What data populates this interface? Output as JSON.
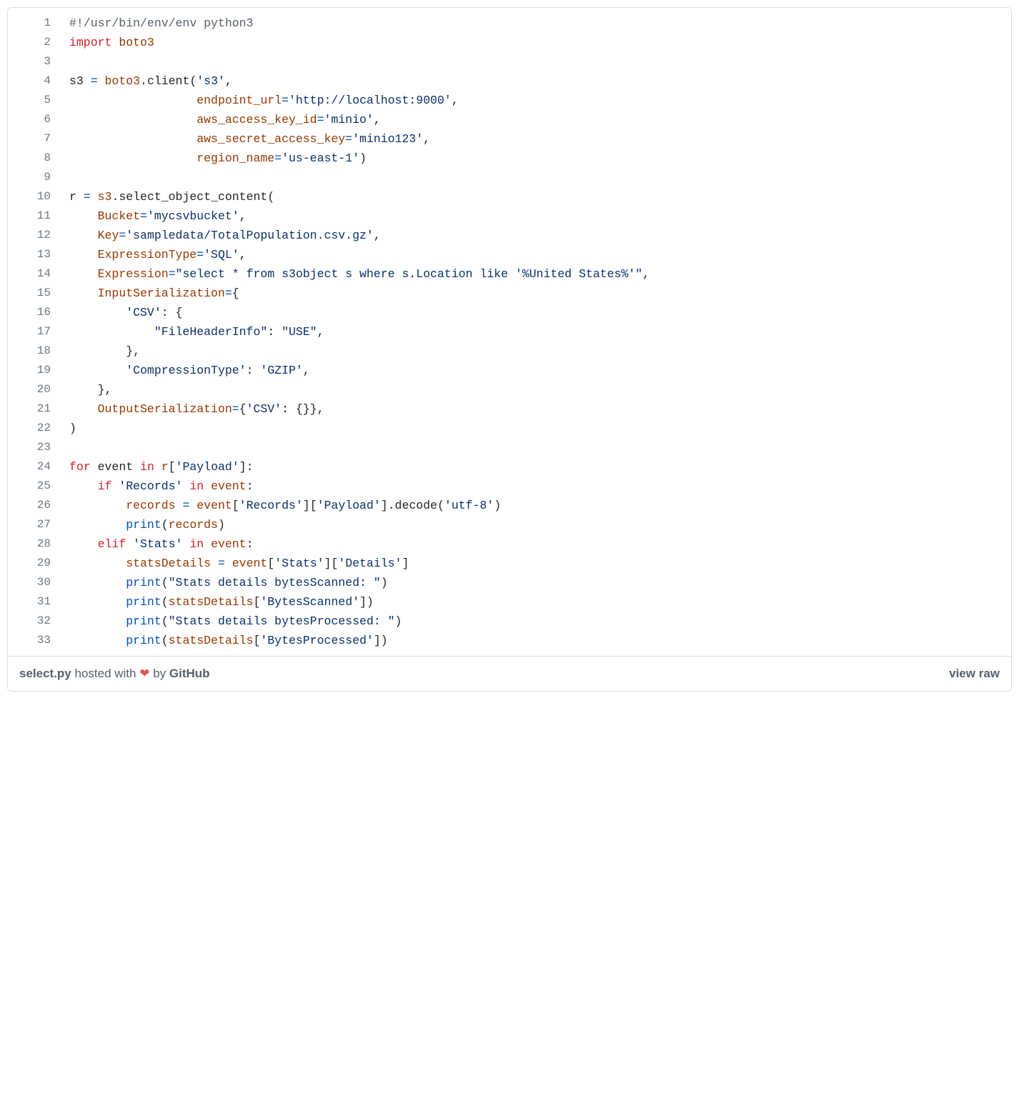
{
  "meta": {
    "filename": "select.py",
    "hosted_with": " hosted with ",
    "by": "  by ",
    "github": "GitHub",
    "view_raw": "view raw",
    "heart": "❤"
  },
  "lines": [
    {
      "n": "1",
      "tokens": [
        [
          "c-cmt",
          "#!/usr/bin/env/env python3"
        ]
      ]
    },
    {
      "n": "2",
      "tokens": [
        [
          "c-kw",
          "import"
        ],
        [
          "c-id",
          " "
        ],
        [
          "c-var",
          "boto3"
        ]
      ]
    },
    {
      "n": "3",
      "tokens": [
        [
          "c-id",
          ""
        ]
      ]
    },
    {
      "n": "4",
      "tokens": [
        [
          "c-id",
          "s3 "
        ],
        [
          "c-op",
          "="
        ],
        [
          "c-id",
          " "
        ],
        [
          "c-var",
          "boto3"
        ],
        [
          "c-id",
          "."
        ],
        [
          "c-id",
          "client"
        ],
        [
          "c-id",
          "("
        ],
        [
          "c-str",
          "'s3'"
        ],
        [
          "c-id",
          ","
        ]
      ]
    },
    {
      "n": "5",
      "tokens": [
        [
          "c-id",
          "                  "
        ],
        [
          "c-var",
          "endpoint_url"
        ],
        [
          "c-op",
          "="
        ],
        [
          "c-str",
          "'http://localhost:9000'"
        ],
        [
          "c-id",
          ","
        ]
      ]
    },
    {
      "n": "6",
      "tokens": [
        [
          "c-id",
          "                  "
        ],
        [
          "c-var",
          "aws_access_key_id"
        ],
        [
          "c-op",
          "="
        ],
        [
          "c-str",
          "'minio'"
        ],
        [
          "c-id",
          ","
        ]
      ]
    },
    {
      "n": "7",
      "tokens": [
        [
          "c-id",
          "                  "
        ],
        [
          "c-var",
          "aws_secret_access_key"
        ],
        [
          "c-op",
          "="
        ],
        [
          "c-str",
          "'minio123'"
        ],
        [
          "c-id",
          ","
        ]
      ]
    },
    {
      "n": "8",
      "tokens": [
        [
          "c-id",
          "                  "
        ],
        [
          "c-var",
          "region_name"
        ],
        [
          "c-op",
          "="
        ],
        [
          "c-str",
          "'us-east-1'"
        ],
        [
          "c-id",
          ")"
        ]
      ]
    },
    {
      "n": "9",
      "tokens": [
        [
          "c-id",
          ""
        ]
      ]
    },
    {
      "n": "10",
      "tokens": [
        [
          "c-id",
          "r "
        ],
        [
          "c-op",
          "="
        ],
        [
          "c-id",
          " "
        ],
        [
          "c-var",
          "s3"
        ],
        [
          "c-id",
          "."
        ],
        [
          "c-id",
          "select_object_content"
        ],
        [
          "c-id",
          "("
        ]
      ]
    },
    {
      "n": "11",
      "tokens": [
        [
          "c-id",
          "    "
        ],
        [
          "c-var",
          "Bucket"
        ],
        [
          "c-op",
          "="
        ],
        [
          "c-str",
          "'mycsvbucket'"
        ],
        [
          "c-id",
          ","
        ]
      ]
    },
    {
      "n": "12",
      "tokens": [
        [
          "c-id",
          "    "
        ],
        [
          "c-var",
          "Key"
        ],
        [
          "c-op",
          "="
        ],
        [
          "c-str",
          "'sampledata/TotalPopulation.csv.gz'"
        ],
        [
          "c-id",
          ","
        ]
      ]
    },
    {
      "n": "13",
      "tokens": [
        [
          "c-id",
          "    "
        ],
        [
          "c-var",
          "ExpressionType"
        ],
        [
          "c-op",
          "="
        ],
        [
          "c-str",
          "'SQL'"
        ],
        [
          "c-id",
          ","
        ]
      ]
    },
    {
      "n": "14",
      "tokens": [
        [
          "c-id",
          "    "
        ],
        [
          "c-var",
          "Expression"
        ],
        [
          "c-op",
          "="
        ],
        [
          "c-str",
          "\"select * from s3object s where s.Location like '%United States%'\""
        ],
        [
          "c-id",
          ","
        ]
      ]
    },
    {
      "n": "15",
      "tokens": [
        [
          "c-id",
          "    "
        ],
        [
          "c-var",
          "InputSerialization"
        ],
        [
          "c-op",
          "="
        ],
        [
          "c-id",
          "{"
        ]
      ]
    },
    {
      "n": "16",
      "tokens": [
        [
          "c-id",
          "        "
        ],
        [
          "c-str",
          "'CSV'"
        ],
        [
          "c-id",
          ": {"
        ]
      ]
    },
    {
      "n": "17",
      "tokens": [
        [
          "c-id",
          "            "
        ],
        [
          "c-str",
          "\"FileHeaderInfo\""
        ],
        [
          "c-id",
          ": "
        ],
        [
          "c-str",
          "\"USE\""
        ],
        [
          "c-id",
          ","
        ]
      ]
    },
    {
      "n": "18",
      "tokens": [
        [
          "c-id",
          "        },"
        ]
      ]
    },
    {
      "n": "19",
      "tokens": [
        [
          "c-id",
          "        "
        ],
        [
          "c-str",
          "'CompressionType'"
        ],
        [
          "c-id",
          ": "
        ],
        [
          "c-str",
          "'GZIP'"
        ],
        [
          "c-id",
          ","
        ]
      ]
    },
    {
      "n": "20",
      "tokens": [
        [
          "c-id",
          "    },"
        ]
      ]
    },
    {
      "n": "21",
      "tokens": [
        [
          "c-id",
          "    "
        ],
        [
          "c-var",
          "OutputSerialization"
        ],
        [
          "c-op",
          "="
        ],
        [
          "c-id",
          "{"
        ],
        [
          "c-str",
          "'CSV'"
        ],
        [
          "c-id",
          ": {}},"
        ]
      ]
    },
    {
      "n": "22",
      "tokens": [
        [
          "c-id",
          ")"
        ]
      ]
    },
    {
      "n": "23",
      "tokens": [
        [
          "c-id",
          ""
        ]
      ]
    },
    {
      "n": "24",
      "tokens": [
        [
          "c-kw",
          "for"
        ],
        [
          "c-id",
          " event "
        ],
        [
          "c-kw",
          "in"
        ],
        [
          "c-id",
          " "
        ],
        [
          "c-var",
          "r"
        ],
        [
          "c-id",
          "["
        ],
        [
          "c-str",
          "'Payload'"
        ],
        [
          "c-id",
          "]:"
        ]
      ]
    },
    {
      "n": "25",
      "tokens": [
        [
          "c-id",
          "    "
        ],
        [
          "c-kw",
          "if"
        ],
        [
          "c-id",
          " "
        ],
        [
          "c-str",
          "'Records'"
        ],
        [
          "c-id",
          " "
        ],
        [
          "c-kw",
          "in"
        ],
        [
          "c-id",
          " "
        ],
        [
          "c-var",
          "event"
        ],
        [
          "c-id",
          ":"
        ]
      ]
    },
    {
      "n": "26",
      "tokens": [
        [
          "c-id",
          "        "
        ],
        [
          "c-var",
          "records"
        ],
        [
          "c-id",
          " "
        ],
        [
          "c-op",
          "="
        ],
        [
          "c-id",
          " "
        ],
        [
          "c-var",
          "event"
        ],
        [
          "c-id",
          "["
        ],
        [
          "c-str",
          "'Records'"
        ],
        [
          "c-id",
          "]["
        ],
        [
          "c-str",
          "'Payload'"
        ],
        [
          "c-id",
          "]."
        ],
        [
          "c-id",
          "decode"
        ],
        [
          "c-id",
          "("
        ],
        [
          "c-str",
          "'utf-8'"
        ],
        [
          "c-id",
          ")"
        ]
      ]
    },
    {
      "n": "27",
      "tokens": [
        [
          "c-id",
          "        "
        ],
        [
          "c-fn",
          "print"
        ],
        [
          "c-id",
          "("
        ],
        [
          "c-var",
          "records"
        ],
        [
          "c-id",
          ")"
        ]
      ]
    },
    {
      "n": "28",
      "tokens": [
        [
          "c-id",
          "    "
        ],
        [
          "c-kw",
          "elif"
        ],
        [
          "c-id",
          " "
        ],
        [
          "c-str",
          "'Stats'"
        ],
        [
          "c-id",
          " "
        ],
        [
          "c-kw",
          "in"
        ],
        [
          "c-id",
          " "
        ],
        [
          "c-var",
          "event"
        ],
        [
          "c-id",
          ":"
        ]
      ]
    },
    {
      "n": "29",
      "tokens": [
        [
          "c-id",
          "        "
        ],
        [
          "c-var",
          "statsDetails"
        ],
        [
          "c-id",
          " "
        ],
        [
          "c-op",
          "="
        ],
        [
          "c-id",
          " "
        ],
        [
          "c-var",
          "event"
        ],
        [
          "c-id",
          "["
        ],
        [
          "c-str",
          "'Stats'"
        ],
        [
          "c-id",
          "]["
        ],
        [
          "c-str",
          "'Details'"
        ],
        [
          "c-id",
          "]"
        ]
      ]
    },
    {
      "n": "30",
      "tokens": [
        [
          "c-id",
          "        "
        ],
        [
          "c-fn",
          "print"
        ],
        [
          "c-id",
          "("
        ],
        [
          "c-str",
          "\"Stats details bytesScanned: \""
        ],
        [
          "c-id",
          ")"
        ]
      ]
    },
    {
      "n": "31",
      "tokens": [
        [
          "c-id",
          "        "
        ],
        [
          "c-fn",
          "print"
        ],
        [
          "c-id",
          "("
        ],
        [
          "c-var",
          "statsDetails"
        ],
        [
          "c-id",
          "["
        ],
        [
          "c-str",
          "'BytesScanned'"
        ],
        [
          "c-id",
          "])"
        ]
      ]
    },
    {
      "n": "32",
      "tokens": [
        [
          "c-id",
          "        "
        ],
        [
          "c-fn",
          "print"
        ],
        [
          "c-id",
          "("
        ],
        [
          "c-str",
          "\"Stats details bytesProcessed: \""
        ],
        [
          "c-id",
          ")"
        ]
      ]
    },
    {
      "n": "33",
      "tokens": [
        [
          "c-id",
          "        "
        ],
        [
          "c-fn",
          "print"
        ],
        [
          "c-id",
          "("
        ],
        [
          "c-var",
          "statsDetails"
        ],
        [
          "c-id",
          "["
        ],
        [
          "c-str",
          "'BytesProcessed'"
        ],
        [
          "c-id",
          "])"
        ]
      ]
    }
  ]
}
